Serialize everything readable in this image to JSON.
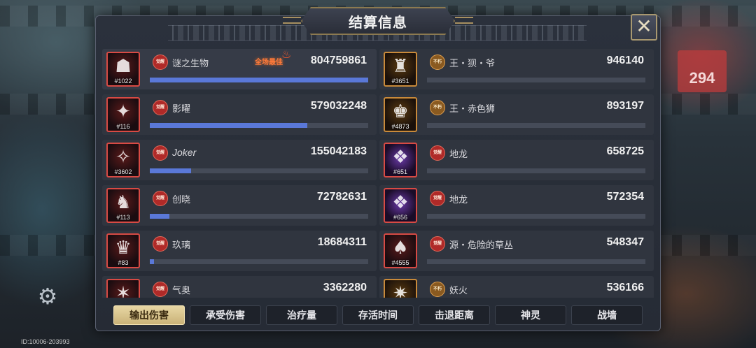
{
  "title": "结算信息",
  "close_icon": "close-x-icon",
  "best_label": "全场最佳",
  "background": {
    "badge_number": "294",
    "footer_id": "ID:10006-203993"
  },
  "left_players": [
    {
      "name": "谜之生物",
      "id": "#1022",
      "value": "804759861",
      "fill": 1.0,
      "frame": "red",
      "glyph": "☗",
      "badge": "觉醒",
      "best": true
    },
    {
      "name": "影曜",
      "id": "#116",
      "value": "579032248",
      "fill": 0.72,
      "frame": "red",
      "glyph": "✦",
      "badge": "觉醒"
    },
    {
      "name": "Joker",
      "id": "#3602",
      "value": "155042183",
      "fill": 0.19,
      "frame": "red",
      "glyph": "✧",
      "badge": "觉醒"
    },
    {
      "name": "创晓",
      "id": "#113",
      "value": "72782631",
      "fill": 0.09,
      "frame": "red",
      "glyph": "♞",
      "badge": "觉醒"
    },
    {
      "name": "玖璃",
      "id": "#83",
      "value": "18684311",
      "fill": 0.02,
      "frame": "red",
      "glyph": "♛",
      "badge": "觉醒"
    },
    {
      "name": "气奥",
      "id": "",
      "value": "3362280",
      "fill": 0.004,
      "frame": "red",
      "glyph": "✶",
      "badge": "觉醒"
    }
  ],
  "right_players": [
    {
      "name": "王・狈・爷",
      "id": "#3651",
      "value": "946140",
      "fill": 0.0,
      "frame": "gold",
      "glyph": "♜",
      "badge": "不朽"
    },
    {
      "name": "王・赤色狮",
      "id": "#4873",
      "value": "893197",
      "fill": 0.0,
      "frame": "gold",
      "glyph": "♚",
      "badge": "不朽"
    },
    {
      "name": "地龙",
      "id": "#651",
      "value": "658725",
      "fill": 0.0,
      "frame": "purple",
      "glyph": "❖",
      "badge": "觉醒"
    },
    {
      "name": "地龙",
      "id": "#656",
      "value": "572354",
      "fill": 0.0,
      "frame": "purple",
      "glyph": "❖",
      "badge": "觉醒"
    },
    {
      "name": "源・危险的草丛",
      "id": "#4555",
      "value": "548347",
      "fill": 0.0,
      "frame": "red",
      "glyph": "♠",
      "badge": "觉醒"
    },
    {
      "name": "妖火",
      "id": "",
      "value": "536166",
      "fill": 0.0,
      "frame": "gold",
      "glyph": "✷",
      "badge": "不朽"
    }
  ],
  "tabs": [
    {
      "label": "输出伤害",
      "active": true
    },
    {
      "label": "承受伤害",
      "active": false
    },
    {
      "label": "治疗量",
      "active": false
    },
    {
      "label": "存活时间",
      "active": false
    },
    {
      "label": "击退距离",
      "active": false
    },
    {
      "label": "神灵",
      "active": false
    },
    {
      "label": "战墙",
      "active": false
    }
  ],
  "colors": {
    "bar_fill": "#5a78d8",
    "best_text": "#ff7a3a",
    "tab_active": "#d8c48e",
    "frame_red": "#d84a44",
    "frame_gold": "#c98a3a"
  }
}
